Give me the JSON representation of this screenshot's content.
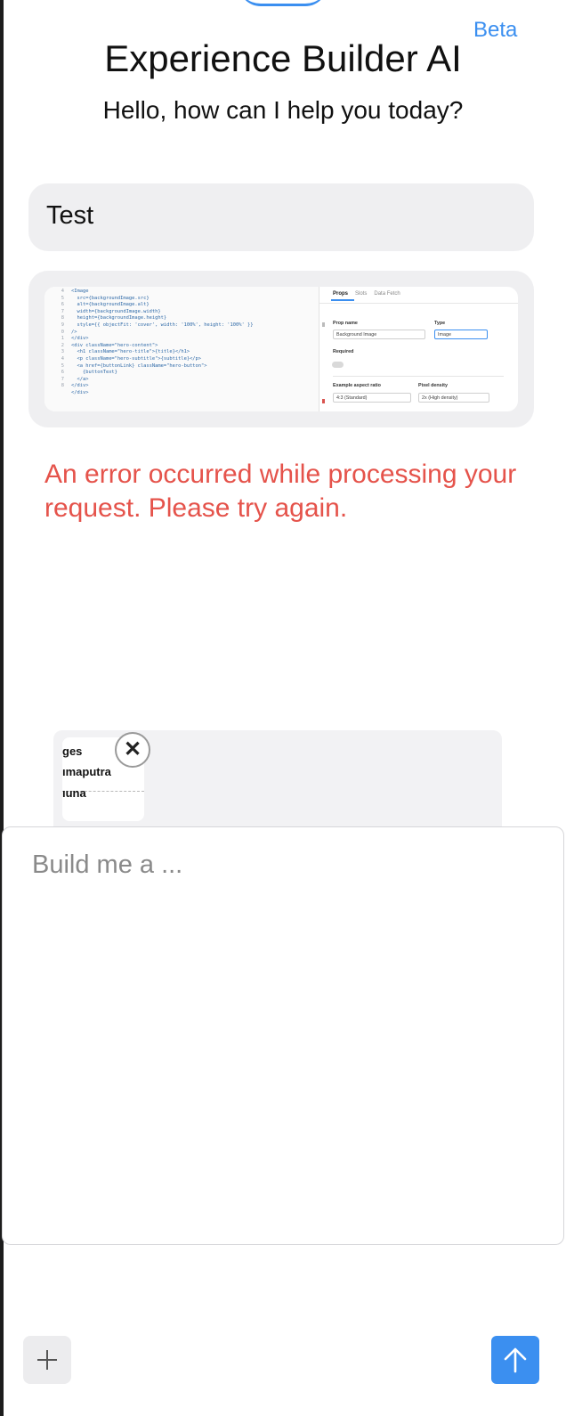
{
  "header": {
    "beta_label": "Beta",
    "title": "Experience Builder AI",
    "subtitle": "Hello, how can I help you today?"
  },
  "conversation": {
    "user_message": "Test",
    "attachment_preview": {
      "code_lines": [
        {
          "num": "4",
          "text": "<Image"
        },
        {
          "num": "5",
          "text": "  src={backgroundImage.src}"
        },
        {
          "num": "6",
          "text": "  alt={backgroundImage.alt}"
        },
        {
          "num": "7",
          "text": "  width={backgroundImage.width}"
        },
        {
          "num": "8",
          "text": "  height={backgroundImage.height}"
        },
        {
          "num": "9",
          "text": "  style={{ objectFit: 'cover', width: '100%', height: '100%' }}"
        },
        {
          "num": "0",
          "text": "/>"
        },
        {
          "num": "1",
          "text": "</div>"
        },
        {
          "num": "2",
          "text": "<div className=\"hero-content\">"
        },
        {
          "num": "3",
          "text": "  <h1 className=\"hero-title\">{title}</h1>"
        },
        {
          "num": "4",
          "text": "  <p className=\"hero-subtitle\">{subtitle}</p>"
        },
        {
          "num": "5",
          "text": "  <a href={buttonLink} className=\"hero-button\">"
        },
        {
          "num": "6",
          "text": "    {buttonText}"
        },
        {
          "num": "7",
          "text": "  </a>"
        },
        {
          "num": "8",
          "text": "</div>"
        },
        {
          "num": "",
          "text": "</div>"
        }
      ],
      "props_panel": {
        "tabs": [
          "Props",
          "Slots",
          "Data Fetch"
        ],
        "prop_name_label": "Prop name",
        "prop_name_value": "Background Image",
        "type_label": "Type",
        "type_value": "Image",
        "required_label": "Required",
        "aspect_label": "Example aspect ratio",
        "aspect_value": "4:3 (Standard)",
        "density_label": "Pixel density",
        "density_value": "2x (High density)"
      }
    },
    "error_message": "An error occurred while processing your request. Please try again."
  },
  "attachment": {
    "lines": [
      "ges",
      "ımaputra",
      "ıuna"
    ],
    "close_glyph": "✕"
  },
  "composer": {
    "placeholder": "Build me a ...",
    "value": ""
  },
  "actions": {
    "plus_icon": "plus-icon",
    "send_icon": "arrow-up-icon"
  },
  "colors": {
    "accent": "#3b8ff0",
    "error": "#e5534b",
    "bubble": "#efeff1"
  }
}
